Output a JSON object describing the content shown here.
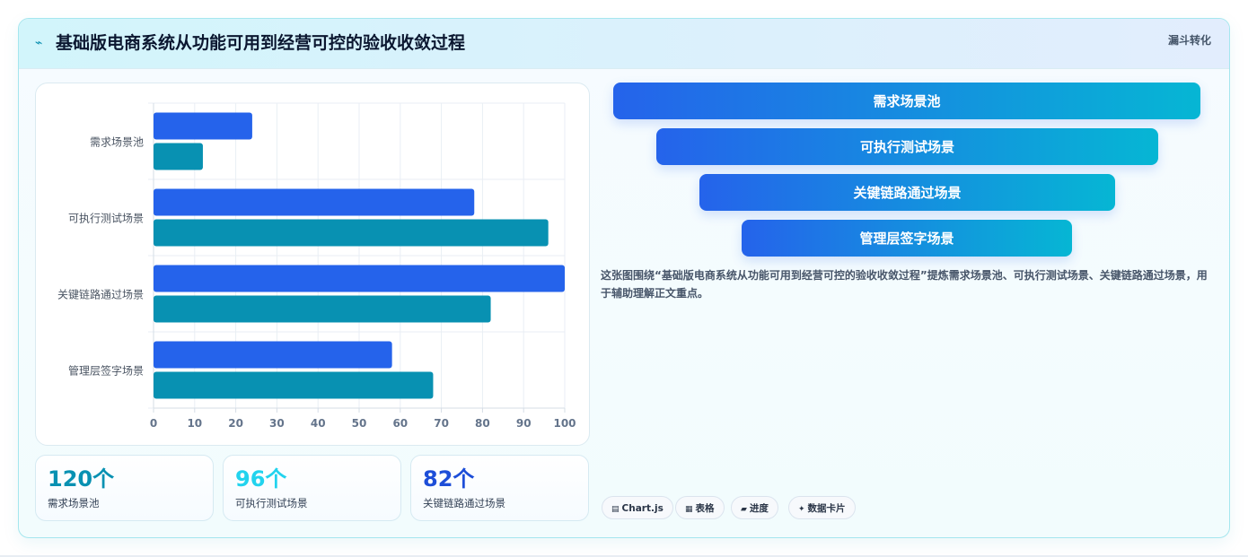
{
  "header": {
    "title": "基础版电商系统从功能可用到经营可控的验收收敛过程",
    "tag": "漏斗转化",
    "icon": "pulse-icon"
  },
  "chart_data": {
    "type": "bar",
    "orientation": "horizontal",
    "categories": [
      "需求场景池",
      "可执行测试场景",
      "关键链路通过场景",
      "管理层签字场景"
    ],
    "series": [
      {
        "color": "#2563eb",
        "values": [
          24,
          78,
          100,
          58
        ]
      },
      {
        "color": "#0891b2",
        "values": [
          12,
          96,
          82,
          68
        ]
      }
    ],
    "xticks": [
      "0",
      "10",
      "20",
      "30",
      "40",
      "50",
      "60",
      "70",
      "80",
      "90",
      "100"
    ],
    "xlim": [
      0,
      100
    ],
    "grid": true,
    "legend": "none"
  },
  "stats": [
    {
      "value": "120个",
      "label": "需求场景池",
      "color": "#0891b2"
    },
    {
      "value": "96个",
      "label": "可执行测试场景",
      "color": "#22d3ee"
    },
    {
      "value": "82个",
      "label": "关键链路通过场景",
      "color": "#1d4ed8"
    }
  ],
  "funnel": [
    {
      "label": "需求场景池"
    },
    {
      "label": "可执行测试场景"
    },
    {
      "label": "关键链路通过场景"
    },
    {
      "label": "管理层签字场景"
    }
  ],
  "description": "这张图围绕“基础版电商系统从功能可用到经营可控的验收收敛过程”提炼需求场景池、可执行测试场景、关键链路通过场景，用于辅助理解正文重点。",
  "chips": [
    {
      "icon": "▤",
      "icon_name": "chart-icon",
      "label": "Chart.js"
    },
    {
      "icon": "▦",
      "icon_name": "table-icon",
      "label": "表格"
    },
    {
      "icon": "▰",
      "icon_name": "progress-icon",
      "label": "进度"
    },
    {
      "icon": "✦",
      "icon_name": "sparkle-icon",
      "label": "数据卡片"
    }
  ]
}
